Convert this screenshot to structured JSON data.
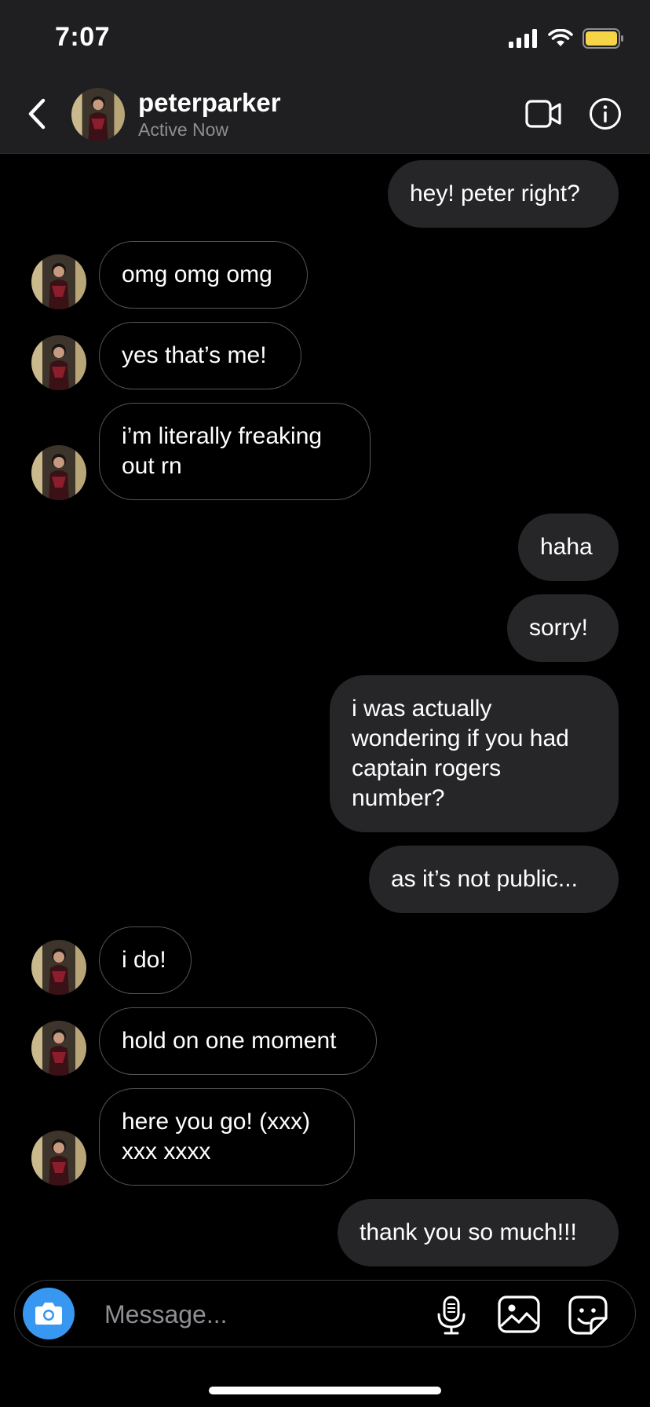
{
  "status": {
    "time": "7:07"
  },
  "header": {
    "name": "peterparker",
    "subtitle": "Active Now"
  },
  "messages": [
    {
      "from": "me",
      "text": "hey! peter right?"
    },
    {
      "from": "them",
      "text": "omg omg omg"
    },
    {
      "from": "them",
      "text": "yes that’s me!"
    },
    {
      "from": "them",
      "text": "i’m literally freaking\nout rn"
    },
    {
      "from": "me",
      "text": "haha"
    },
    {
      "from": "me",
      "text": "sorry!"
    },
    {
      "from": "me",
      "text": "i was actually\nwondering if you had\ncaptain rogers\nnumber?"
    },
    {
      "from": "me",
      "text": "as it’s not public..."
    },
    {
      "from": "them",
      "text": "i do!"
    },
    {
      "from": "them",
      "text": "hold on one moment"
    },
    {
      "from": "them",
      "text": "here you go! (xxx)\nxxx xxxx"
    },
    {
      "from": "me",
      "text": "thank you so much!!!"
    }
  ],
  "composer": {
    "placeholder": "Message..."
  },
  "icons": {
    "back": "chevron-left-icon",
    "video": "video-camera-icon",
    "info": "info-icon",
    "camera": "camera-icon",
    "mic": "microphone-icon",
    "gallery": "gallery-icon",
    "sticker": "sticker-icon"
  },
  "colors": {
    "background": "#000000",
    "header": "#1f1f21",
    "sent_bubble": "#262628",
    "received_border": "#555555",
    "camera_button": "#3897f0",
    "battery": "#f5d547"
  }
}
